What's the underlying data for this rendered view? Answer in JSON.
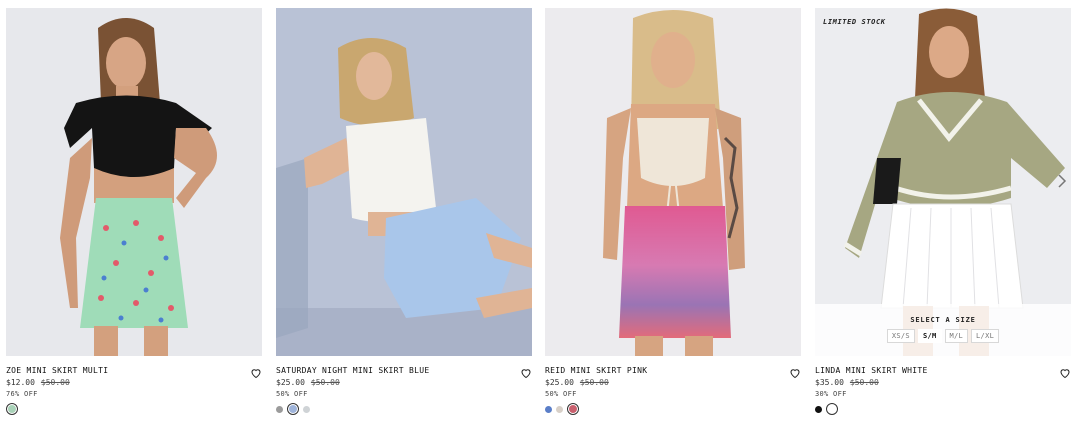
{
  "colors": {
    "text": "#222222",
    "photo_bg_1": "#e7e8ec",
    "photo_bg_2": "#b9c2d6",
    "photo_bg_3": "#ecebee",
    "photo_bg_4": "#ecedf0"
  },
  "products": [
    {
      "title": "ZOE MINI SKIRT MULTI",
      "price": "$12.00",
      "original_price": "$50.00",
      "discount": "76% OFF",
      "swatches": [
        {
          "color": "#a9d2b8",
          "selected": true
        }
      ]
    },
    {
      "title": "SATURDAY NIGHT MINI SKIRT BLUE",
      "price": "$25.00",
      "original_price": "$50.00",
      "discount": "50% OFF",
      "swatches": [
        {
          "color": "#9b9b9b",
          "selected": false
        },
        {
          "color": "#9fb4da",
          "selected": true
        },
        {
          "color": "#cfd3d6",
          "selected": false
        }
      ]
    },
    {
      "title": "REID MINI SKIRT PINK",
      "price": "$25.00",
      "original_price": "$50.00",
      "discount": "50% OFF",
      "swatches": [
        {
          "color": "#5a7ec8",
          "selected": false
        },
        {
          "color": "#d8d0c8",
          "selected": false
        },
        {
          "color": "#c9606e",
          "selected": true
        }
      ]
    },
    {
      "title": "LINDA MINI SKIRT WHITE",
      "price": "$35.00",
      "original_price": "$50.00",
      "discount": "30% OFF",
      "badge": "LIMITED STOCK",
      "size_title": "SELECT A SIZE",
      "sizes": [
        "XS/S",
        "S/M",
        "M/L",
        "L/XL"
      ],
      "available_sizes": [
        "S/M"
      ],
      "swatches": [
        {
          "color": "#111111",
          "selected": false
        },
        {
          "color": "#ffffff",
          "selected": true
        }
      ]
    }
  ],
  "icons": {
    "wishlist": "heart-icon",
    "carousel_next": "chevron-right-icon"
  }
}
